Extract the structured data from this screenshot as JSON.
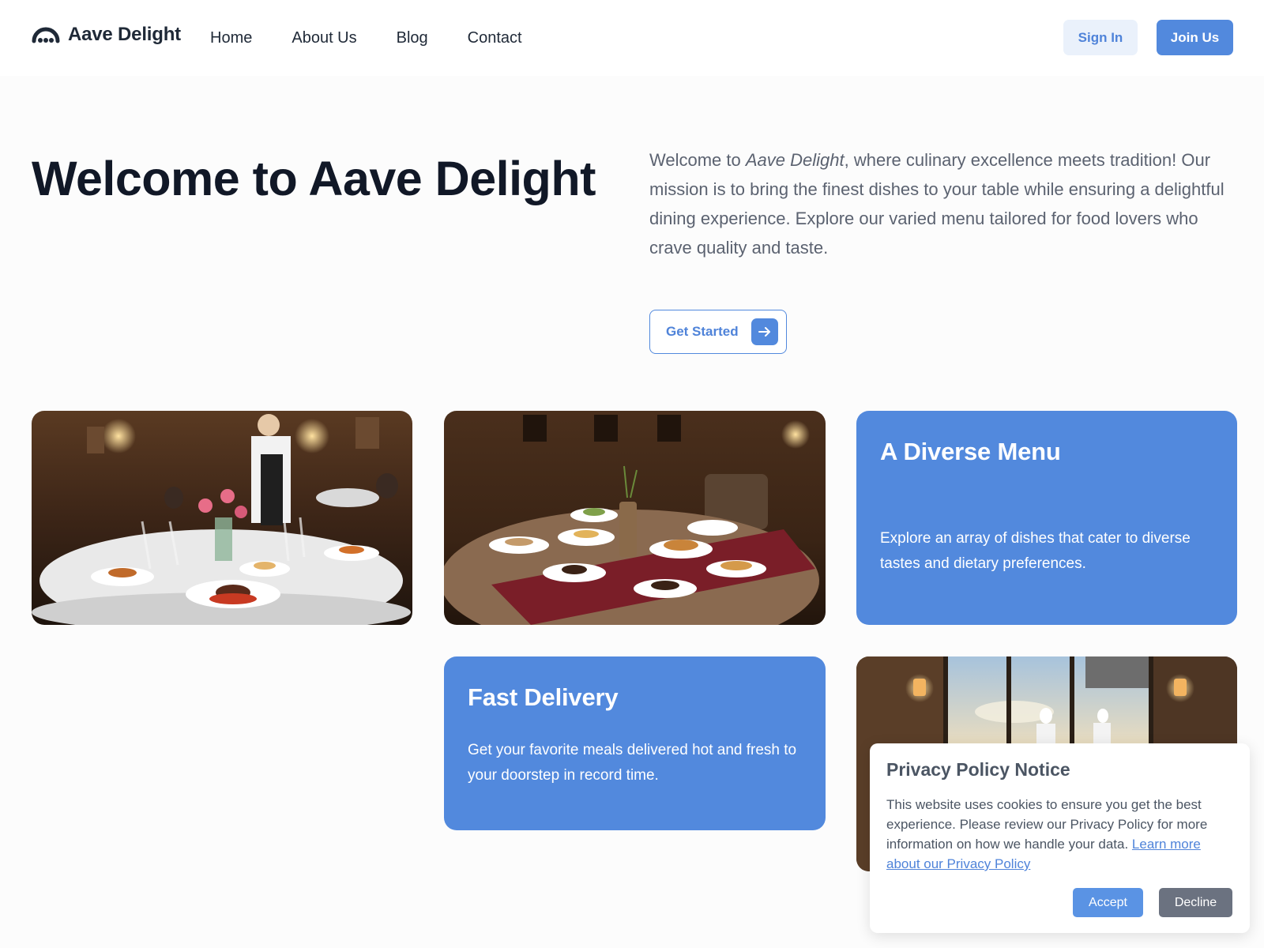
{
  "header": {
    "brand": "Aave Delight",
    "nav": [
      "Home",
      "About Us",
      "Blog",
      "Contact"
    ],
    "sign_in": "Sign In",
    "join_us": "Join Us"
  },
  "hero": {
    "title": "Welcome to Aave Delight",
    "desc_prefix": "Welcome to ",
    "desc_brand": "Aave Delight",
    "desc_rest": ", where culinary excellence meets tradition! Our mission is to bring the finest dishes to your table while ensuring a delightful dining experience. Explore our varied menu tailored for food lovers who crave quality and taste.",
    "cta": "Get Started"
  },
  "cards": {
    "diverse_menu": {
      "title": "A Diverse Menu",
      "text": "Explore an array of dishes that cater to diverse tastes and dietary preferences."
    },
    "fast_delivery": {
      "title": "Fast Delivery",
      "text": "Get your favorite meals delivered hot and fresh to your doorstep in record time."
    }
  },
  "privacy": {
    "title": "Privacy Policy Notice",
    "text": "This website uses cookies to ensure you get the best experience. Please review our Privacy Policy for more information on how we handle your data. ",
    "link": "Learn more about our Privacy Policy",
    "accept": "Accept",
    "decline": "Decline"
  },
  "colors": {
    "accent": "#5289dd",
    "accent_light": "#eaf1fb",
    "heading": "#111827",
    "body_text": "#5b6270",
    "decline": "#6b7280"
  },
  "icons": [
    "logo-arc-icon",
    "arrow-right-icon"
  ]
}
